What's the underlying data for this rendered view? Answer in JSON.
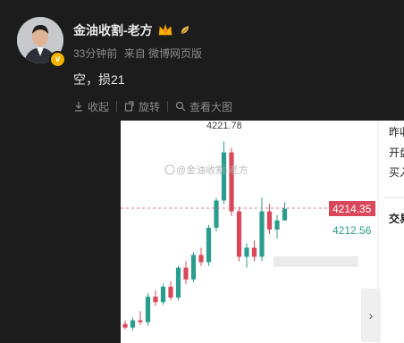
{
  "post": {
    "username": "金油收割-老方",
    "time": "33分钟前",
    "source": "来自 微博网页版",
    "text": "空，损21"
  },
  "toolbar": {
    "collapse": "收起",
    "rotate": "旋转",
    "view_large": "查看大图"
  },
  "chart": {
    "high_label": "4221.78",
    "current_price": "4214.35",
    "secondary_price": "4212.56",
    "watermark": "@金油收割-老方",
    "right_labels": [
      "昨收",
      "开盘",
      "买入",
      "交易"
    ]
  },
  "chart_data": {
    "type": "candlestick",
    "title": "",
    "ylim": [
      4199.5,
      4224.0
    ],
    "up_color": "#2a9d8f",
    "down_color": "#d9475b",
    "candles": [
      {
        "o": 4201.6,
        "h": 4202.0,
        "l": 4201.0,
        "c": 4201.2
      },
      {
        "o": 4201.2,
        "h": 4202.3,
        "l": 4200.9,
        "c": 4202.0
      },
      {
        "o": 4202.0,
        "h": 4203.0,
        "l": 4201.5,
        "c": 4201.8
      },
      {
        "o": 4201.8,
        "h": 4205.0,
        "l": 4201.4,
        "c": 4204.6
      },
      {
        "o": 4204.6,
        "h": 4205.3,
        "l": 4203.6,
        "c": 4204.0
      },
      {
        "o": 4204.0,
        "h": 4206.0,
        "l": 4203.7,
        "c": 4205.7
      },
      {
        "o": 4205.7,
        "h": 4206.3,
        "l": 4204.2,
        "c": 4204.5
      },
      {
        "o": 4204.5,
        "h": 4208.0,
        "l": 4204.2,
        "c": 4207.8
      },
      {
        "o": 4207.8,
        "h": 4208.5,
        "l": 4206.0,
        "c": 4206.5
      },
      {
        "o": 4206.5,
        "h": 4209.5,
        "l": 4206.2,
        "c": 4209.2
      },
      {
        "o": 4209.2,
        "h": 4210.0,
        "l": 4208.0,
        "c": 4208.4
      },
      {
        "o": 4208.4,
        "h": 4212.5,
        "l": 4208.0,
        "c": 4212.2
      },
      {
        "o": 4212.2,
        "h": 4215.5,
        "l": 4211.8,
        "c": 4215.2
      },
      {
        "o": 4215.2,
        "h": 4221.7,
        "l": 4214.8,
        "c": 4220.5
      },
      {
        "o": 4220.5,
        "h": 4221.0,
        "l": 4213.5,
        "c": 4214.0
      },
      {
        "o": 4214.0,
        "h": 4214.5,
        "l": 4208.5,
        "c": 4209.0
      },
      {
        "o": 4209.0,
        "h": 4210.5,
        "l": 4207.8,
        "c": 4210.0
      },
      {
        "o": 4210.0,
        "h": 4210.8,
        "l": 4208.5,
        "c": 4209.0
      },
      {
        "o": 4209.0,
        "h": 4215.5,
        "l": 4208.5,
        "c": 4214.0
      },
      {
        "o": 4214.0,
        "h": 4214.8,
        "l": 4211.5,
        "c": 4212.0
      },
      {
        "o": 4212.0,
        "h": 4213.6,
        "l": 4211.0,
        "c": 4213.0
      },
      {
        "o": 4213.0,
        "h": 4215.0,
        "l": 4213.0,
        "c": 4214.3
      }
    ]
  }
}
